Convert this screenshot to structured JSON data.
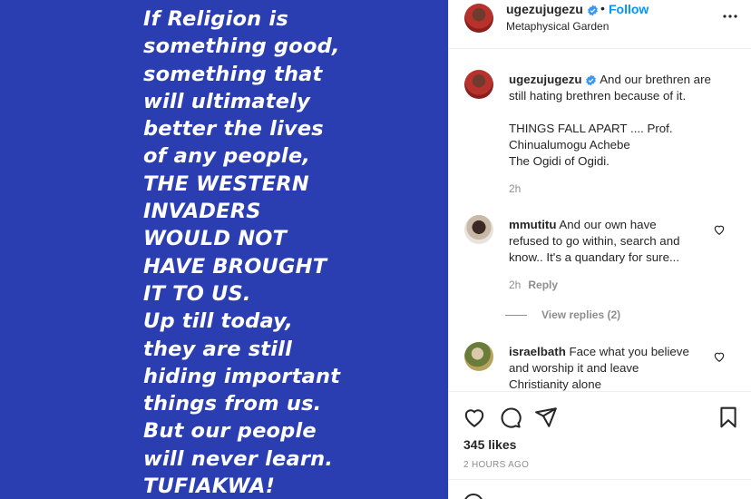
{
  "image": {
    "background_color": "#2a3eb1",
    "lines": [
      "If Religion is",
      "something good,",
      "something that",
      "will ultimately",
      "better the lives",
      "of any people,",
      "THE WESTERN",
      "INVADERS",
      "WOULD NOT",
      "HAVE BROUGHT",
      "IT TO US.",
      "Up till today,",
      "they are still",
      "hiding important",
      "things from us.",
      "But our people",
      "will never learn.",
      "TUFIAKWA!"
    ]
  },
  "header": {
    "username": "ugezujugezu",
    "separator": "•",
    "follow_label": "Follow",
    "location": "Metaphysical Garden",
    "more_icon": "more-horizontal-icon"
  },
  "caption": {
    "username": "ugezujugezu",
    "text_line1": "And our brethren are",
    "text_line2": "still hating brethren because of it.",
    "text_line3": "THINGS FALL APART .... Prof.",
    "text_line4": "Chinualumogu Achebe",
    "text_line5": "The Ogidi of Ogidi.",
    "time": "2h"
  },
  "comments": [
    {
      "username": "mmutitu",
      "text_line1": "And our own have",
      "text_line2": "refused to go within, search and",
      "text_line3": "know.. It's a quandary for sure...",
      "time": "2h",
      "reply_label": "Reply",
      "view_replies": "View replies (2)"
    },
    {
      "username": "israelbath",
      "text_line1": "Face what you believe",
      "text_line2": "and worship it and leave",
      "text_line3": "Christianity alone"
    }
  ],
  "actions": {
    "likes": "345 likes",
    "time": "2 HOURS AGO"
  },
  "colors": {
    "accent": "#0095f6",
    "verified": "#3897f0",
    "muted": "#8e8e8e",
    "text": "#262626"
  }
}
